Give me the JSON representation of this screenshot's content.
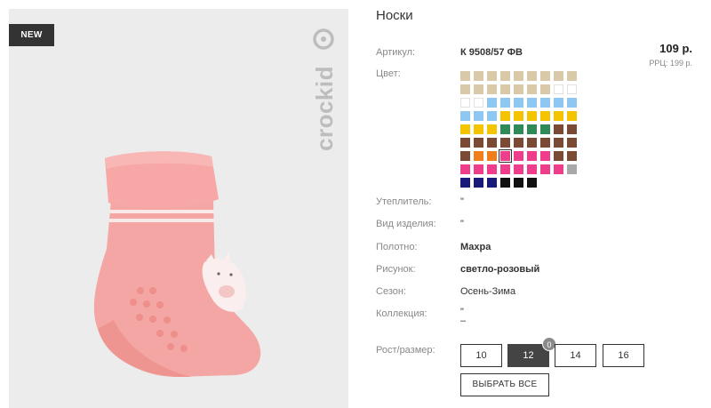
{
  "badge": "NEW",
  "brand": "crockid",
  "product": {
    "title": "Носки",
    "article_label": "Артикул:",
    "article_value": "К 9508/57 ФВ",
    "price": "109 р.",
    "rrp": "РРЦ: 199 р.",
    "color_label": "Цвет:"
  },
  "swatch_colors": [
    "#d9c9a8",
    "#d9c9a8",
    "#d9c9a8",
    "#d9c9a8",
    "#d9c9a8",
    "#d9c9a8",
    "#d9c9a8",
    "#d9c9a8",
    "#d9c9a8",
    "#d9c9a8",
    "#d9c9a8",
    "#d9c9a8",
    "#d9c9a8",
    "#d9c9a8",
    "#d9c9a8",
    "#d9c9a8",
    "#ffffff",
    "#ffffff",
    "#ffffff",
    "#ffffff",
    "#8ec8f2",
    "#8ec8f2",
    "#8ec8f2",
    "#8ec8f2",
    "#8ec8f2",
    "#8ec8f2",
    "#8ec8f2",
    "#8ec8f2",
    "#8ec8f2",
    "#8ec8f2",
    "#f5c400",
    "#f5c400",
    "#f5c400",
    "#f5c400",
    "#f5c400",
    "#f5c400",
    "#f5c400",
    "#f5c400",
    "#f5c400",
    "#2e8b57",
    "#2e8b57",
    "#2e8b57",
    "#2e8b57",
    "#7a4a35",
    "#7a4a35",
    "#7a4a35",
    "#7a4a35",
    "#7a4a35",
    "#7a4a35",
    "#7a4a35",
    "#7a4a35",
    "#7a4a35",
    "#7a4a35",
    "#7a4a35",
    "#7a4a35",
    "#f07e1a",
    "#f07e1a",
    "#ee3d8a",
    "#ee3d8a",
    "#ee3d8a",
    "#ee3d8a",
    "#7a4a35",
    "#7a4a35",
    "#ee3d8a",
    "#ee3d8a",
    "#ee3d8a",
    "#ee3d8a",
    "#ee3d8a",
    "#ee3d8a",
    "#ee3d8a",
    "#ee3d8a",
    "#a8a8a8",
    "#1a1a7a",
    "#1a1a7a",
    "#1a1a7a",
    "#111111",
    "#111111",
    "#111111"
  ],
  "swatch_selected_index": 57,
  "specs": [
    {
      "label": "Утеплитель:",
      "value": "\"",
      "bold": false
    },
    {
      "label": "Вид изделия:",
      "value": "\"",
      "bold": false
    },
    {
      "label": "Полотно:",
      "value": "Махра",
      "bold": true
    },
    {
      "label": "Рисунок:",
      "value": "светло-розовый",
      "bold": true
    },
    {
      "label": "Сезон:",
      "value": "Осень-Зима",
      "bold": false
    },
    {
      "label": "Коллекция:",
      "value": "\"",
      "bold": false
    }
  ],
  "collection_extra": "–",
  "size": {
    "label": "Рост/размер:",
    "options": [
      "10",
      "12",
      "14",
      "16"
    ],
    "active": "12",
    "stock_count": "0",
    "select_all": "ВЫБРАТЬ ВСЕ"
  }
}
